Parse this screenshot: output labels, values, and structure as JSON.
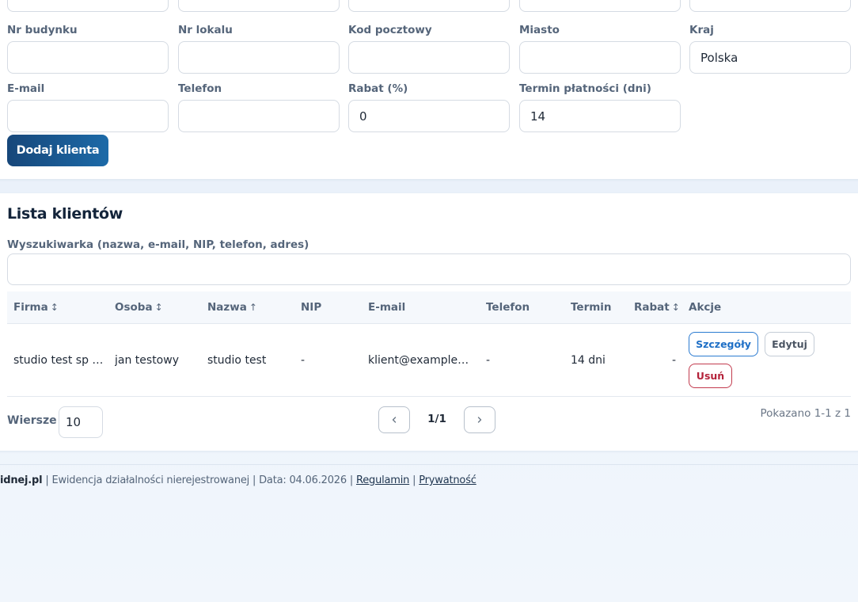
{
  "form": {
    "fields": [
      {
        "key": "building_no",
        "label": "Nr budynku",
        "value": ""
      },
      {
        "key": "apartment_no",
        "label": "Nr lokalu",
        "value": ""
      },
      {
        "key": "postal_code",
        "label": "Kod pocztowy",
        "value": ""
      },
      {
        "key": "city",
        "label": "Miasto",
        "value": ""
      },
      {
        "key": "country",
        "label": "Kraj",
        "value": "Polska"
      },
      {
        "key": "email",
        "label": "E-mail",
        "value": ""
      },
      {
        "key": "phone",
        "label": "Telefon",
        "value": ""
      },
      {
        "key": "discount",
        "label": "Rabat (%)",
        "value": "0"
      },
      {
        "key": "payment_term",
        "label": "Termin płatności (dni)",
        "value": "14"
      }
    ],
    "submit_label": "Dodaj klienta"
  },
  "list": {
    "title": "Lista klientów",
    "search": {
      "label": "Wyszukiwarka (nazwa, e-mail, NIP, telefon, adres)",
      "value": ""
    },
    "columns": [
      {
        "label": "Firma",
        "sort": "↕"
      },
      {
        "label": "Osoba",
        "sort": "↕"
      },
      {
        "label": "Nazwa",
        "sort": "↑"
      },
      {
        "label": "NIP",
        "sort": ""
      },
      {
        "label": "E-mail",
        "sort": ""
      },
      {
        "label": "Telefon",
        "sort": ""
      },
      {
        "label": "Termin",
        "sort": ""
      },
      {
        "label": "Rabat",
        "sort": "↕"
      },
      {
        "label": "Akcje",
        "sort": ""
      }
    ],
    "rows": [
      {
        "company": "studio test sp z o.o.",
        "person": "jan testowy",
        "name": "studio test",
        "nip": "-",
        "email": "klient@example.com",
        "phone": "-",
        "term": "14 dni",
        "discount": "-",
        "actions": {
          "details": "Szczegóły",
          "edit": "Edytuj",
          "delete": "Usuń"
        }
      }
    ],
    "pagination": {
      "rows_label": "Wiersze",
      "rows_per_page": "10",
      "page_indicator": "1/1",
      "shown_text": "Pokazano 1-1 z 1"
    }
  },
  "footer": {
    "brand": "idnej.pl",
    "sep": " | ",
    "description": "Ewidencja działalności nierejestrowanej",
    "date_text": "Data: 04.06.2026",
    "terms_link": "Regulamin",
    "privacy_link": "Prywatność"
  },
  "colors": {
    "primary_button_start": "#17477a",
    "primary_button_end": "#1c6aa8",
    "details_button": "#1e6fc6",
    "delete_button": "#b4233b",
    "page_background": "#e6eef8"
  }
}
